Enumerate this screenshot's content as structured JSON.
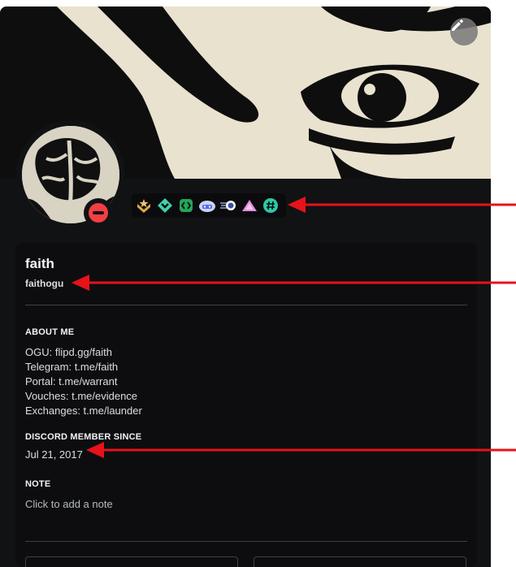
{
  "profile": {
    "display_name": "faith",
    "username": "faithogu",
    "status": "do-not-disturb",
    "status_color": "#f23f43"
  },
  "badges": [
    {
      "name": "hypesquad-bravery-icon"
    },
    {
      "name": "nitro-gem-icon"
    },
    {
      "name": "active-developer-icon"
    },
    {
      "name": "quest-completer-icon"
    },
    {
      "name": "orbs-icon"
    },
    {
      "name": "triangle-badge-icon"
    },
    {
      "name": "hashtag-badge-icon"
    }
  ],
  "about": {
    "heading": "ABOUT ME",
    "lines": [
      "OGU: flipd.gg/faith",
      "Telegram: t.me/faith",
      "Portal: t.me/warrant",
      "Vouches: t.me/evidence",
      "Exchanges: t.me/launder"
    ]
  },
  "member_since": {
    "heading": "DISCORD MEMBER SINCE",
    "date": "Jul 21, 2017"
  },
  "note": {
    "heading": "NOTE",
    "placeholder": "Click to add a note"
  },
  "colors": {
    "card_bg": "#111214",
    "panel_bg": "#0d0d0f",
    "annotation_arrow": "#e8121a"
  }
}
